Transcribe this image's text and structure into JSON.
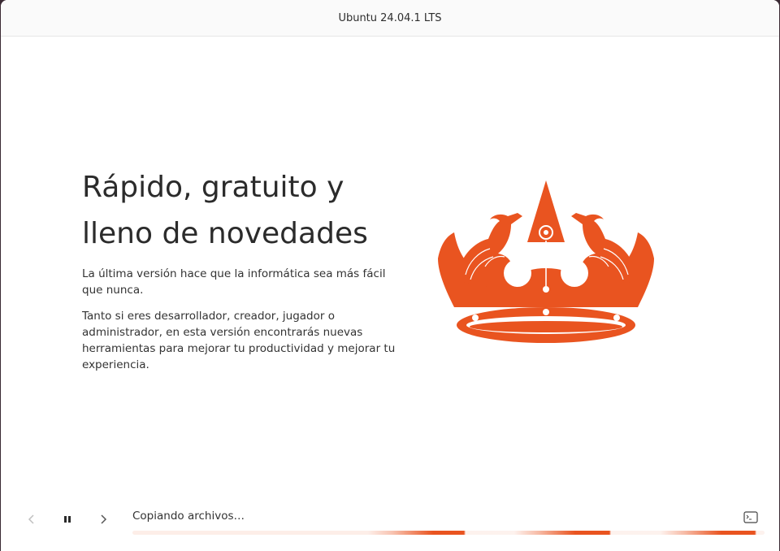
{
  "window": {
    "title": "Ubuntu 24.04.1 LTS"
  },
  "slide": {
    "headline_line1": "Rápido, gratuito y",
    "headline_line2": "lleno de novedades",
    "paragraph1": "La última versión hace que la informática sea más fácil que nunca.",
    "paragraph2": "Tanto si eres desarrollador, creador, jugador o administrador, en esta versión encontrarás nuevas herramientas para mejorar tu productividad y mejorar tu experiencia.",
    "illustration": "ubuntu-crown-icon"
  },
  "footer": {
    "prev_icon": "chevron-left-icon",
    "pause_icon": "pause-icon",
    "next_icon": "chevron-right-icon",
    "status": "Copiando archivos…",
    "terminal_icon": "terminal-icon",
    "progress_state": "indeterminate"
  },
  "colors": {
    "accent": "#e95420",
    "text": "#2b2b2b",
    "background": "#ffffff"
  }
}
